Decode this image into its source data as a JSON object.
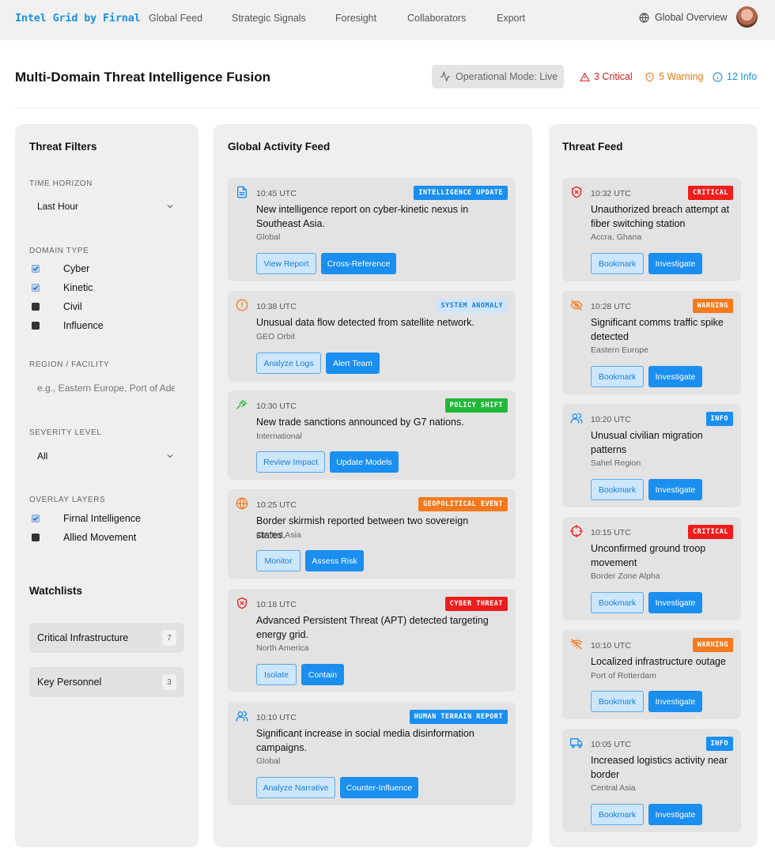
{
  "brand": "Intel Grid by Firnal",
  "nav": [
    "Global Feed",
    "Strategic Signals",
    "Foresight",
    "Collaborators",
    "Export"
  ],
  "global_overview": "Global Overview",
  "page_title": "Multi-Domain Threat Intelligence Fusion",
  "operational_mode": "Operational Mode: Live",
  "counts": {
    "critical": "3 Critical",
    "warning": "5 Warning",
    "info": "12 Info"
  },
  "filters": {
    "title": "Threat Filters",
    "time_label": "TIME HORIZON",
    "time_value": "Last Hour",
    "domain_label": "DOMAIN TYPE",
    "domains": [
      {
        "label": "Cyber",
        "checked": true
      },
      {
        "label": "Kinetic",
        "checked": true
      },
      {
        "label": "Civil",
        "checked": false
      },
      {
        "label": "Influence",
        "checked": false
      }
    ],
    "region_label": "REGION / FACILITY",
    "region_placeholder": "e.g., Eastern Europe, Port of Aden",
    "severity_label": "SEVERITY LEVEL",
    "severity_value": "All",
    "overlay_label": "OVERLAY LAYERS",
    "overlays": [
      {
        "label": "Firnal Intelligence",
        "checked": true
      },
      {
        "label": "Allied Movement",
        "checked": false
      }
    ]
  },
  "watchlists": {
    "title": "Watchlists",
    "items": [
      {
        "label": "Critical Infrastructure",
        "count": "7"
      },
      {
        "label": "Key Personnel",
        "count": "3"
      }
    ]
  },
  "activity": {
    "title": "Global Activity Feed",
    "items": [
      {
        "icon": "document-icon",
        "time": "10:45 UTC",
        "tag": "INTELLIGENCE UPDATE",
        "tag_style": "blue",
        "text": "New intelligence report on cyber-kinetic nexus in Southeast Asia.",
        "loc": "Global",
        "b1": "View Report",
        "b2": "Cross-Reference"
      },
      {
        "icon": "alert-circle-icon",
        "time": "10:38 UTC",
        "tag": "SYSTEM ANOMALY",
        "tag_style": "lightblue",
        "text": "Unusual data flow detected from satellite network.",
        "loc": "GEO Orbit",
        "b1": "Analyze Logs",
        "b2": "Alert Team"
      },
      {
        "icon": "gavel-icon",
        "time": "10:30 UTC",
        "tag": "POLICY SHIFT",
        "tag_style": "green",
        "text": "New trade sanctions announced by G7 nations.",
        "loc": "International",
        "b1": "Review Impact",
        "b2": "Update Models"
      },
      {
        "icon": "globe-icon",
        "time": "10:25 UTC",
        "tag": "GEOPOLITICAL EVENT",
        "tag_style": "orange",
        "text": "Border skirmish reported between two sovereign states.",
        "loc": "Central Asia",
        "b1": "Monitor",
        "b2": "Assess Risk"
      },
      {
        "icon": "shield-x-icon",
        "time": "10:18 UTC",
        "tag": "CYBER THREAT",
        "tag_style": "red",
        "text": "Advanced Persistent Threat (APT) detected targeting energy grid.",
        "loc": "North America",
        "b1": "Isolate",
        "b2": "Contain"
      },
      {
        "icon": "users-icon",
        "time": "10:10 UTC",
        "tag": "HUMAN TERRAIN REPORT",
        "tag_style": "blue",
        "text": "Significant increase in social media disinformation campaigns.",
        "loc": "Global",
        "b1": "Analyze Narrative",
        "b2": "Counter-Influence"
      }
    ]
  },
  "threats": {
    "title": "Threat Feed",
    "bookmark": "Bookmark",
    "investigate": "Investigate",
    "items": [
      {
        "icon": "shield-x-icon",
        "time": "10:32 UTC",
        "tag": "CRITICAL",
        "tag_style": "red",
        "text": "Unauthorized breach attempt at fiber switching station",
        "loc": "Accra, Ghana"
      },
      {
        "icon": "eye-off-icon",
        "time": "10:28 UTC",
        "tag": "WARNING",
        "tag_style": "orange",
        "text": "Significant comms traffic spike detected",
        "loc": "Eastern Europe"
      },
      {
        "icon": "users-icon",
        "time": "10:20 UTC",
        "tag": "INFO",
        "tag_style": "blue",
        "text": "Unusual civilian migration patterns",
        "loc": "Sahel Region"
      },
      {
        "icon": "crosshair-icon",
        "time": "10:15 UTC",
        "tag": "CRITICAL",
        "tag_style": "red",
        "text": "Unconfirmed ground troop movement",
        "loc": "Border Zone Alpha"
      },
      {
        "icon": "wifi-off-icon",
        "time": "10:10 UTC",
        "tag": "WARNING",
        "tag_style": "orange",
        "text": "Localized infrastructure outage",
        "loc": "Port of Rotterdam"
      },
      {
        "icon": "truck-icon",
        "time": "10:05 UTC",
        "tag": "INFO",
        "tag_style": "blue",
        "text": "Increased logistics activity near border",
        "loc": "Central Asia"
      }
    ]
  },
  "colors": {
    "blue": "#1a8ff0",
    "lightblue": "#cfe5fb",
    "green": "#22b83a",
    "orange": "#f57a1d",
    "red": "#ee1c1c",
    "critical_text": "#d71d1d",
    "warning_text": "#ee7a12",
    "info_text": "#1a8ff0"
  }
}
